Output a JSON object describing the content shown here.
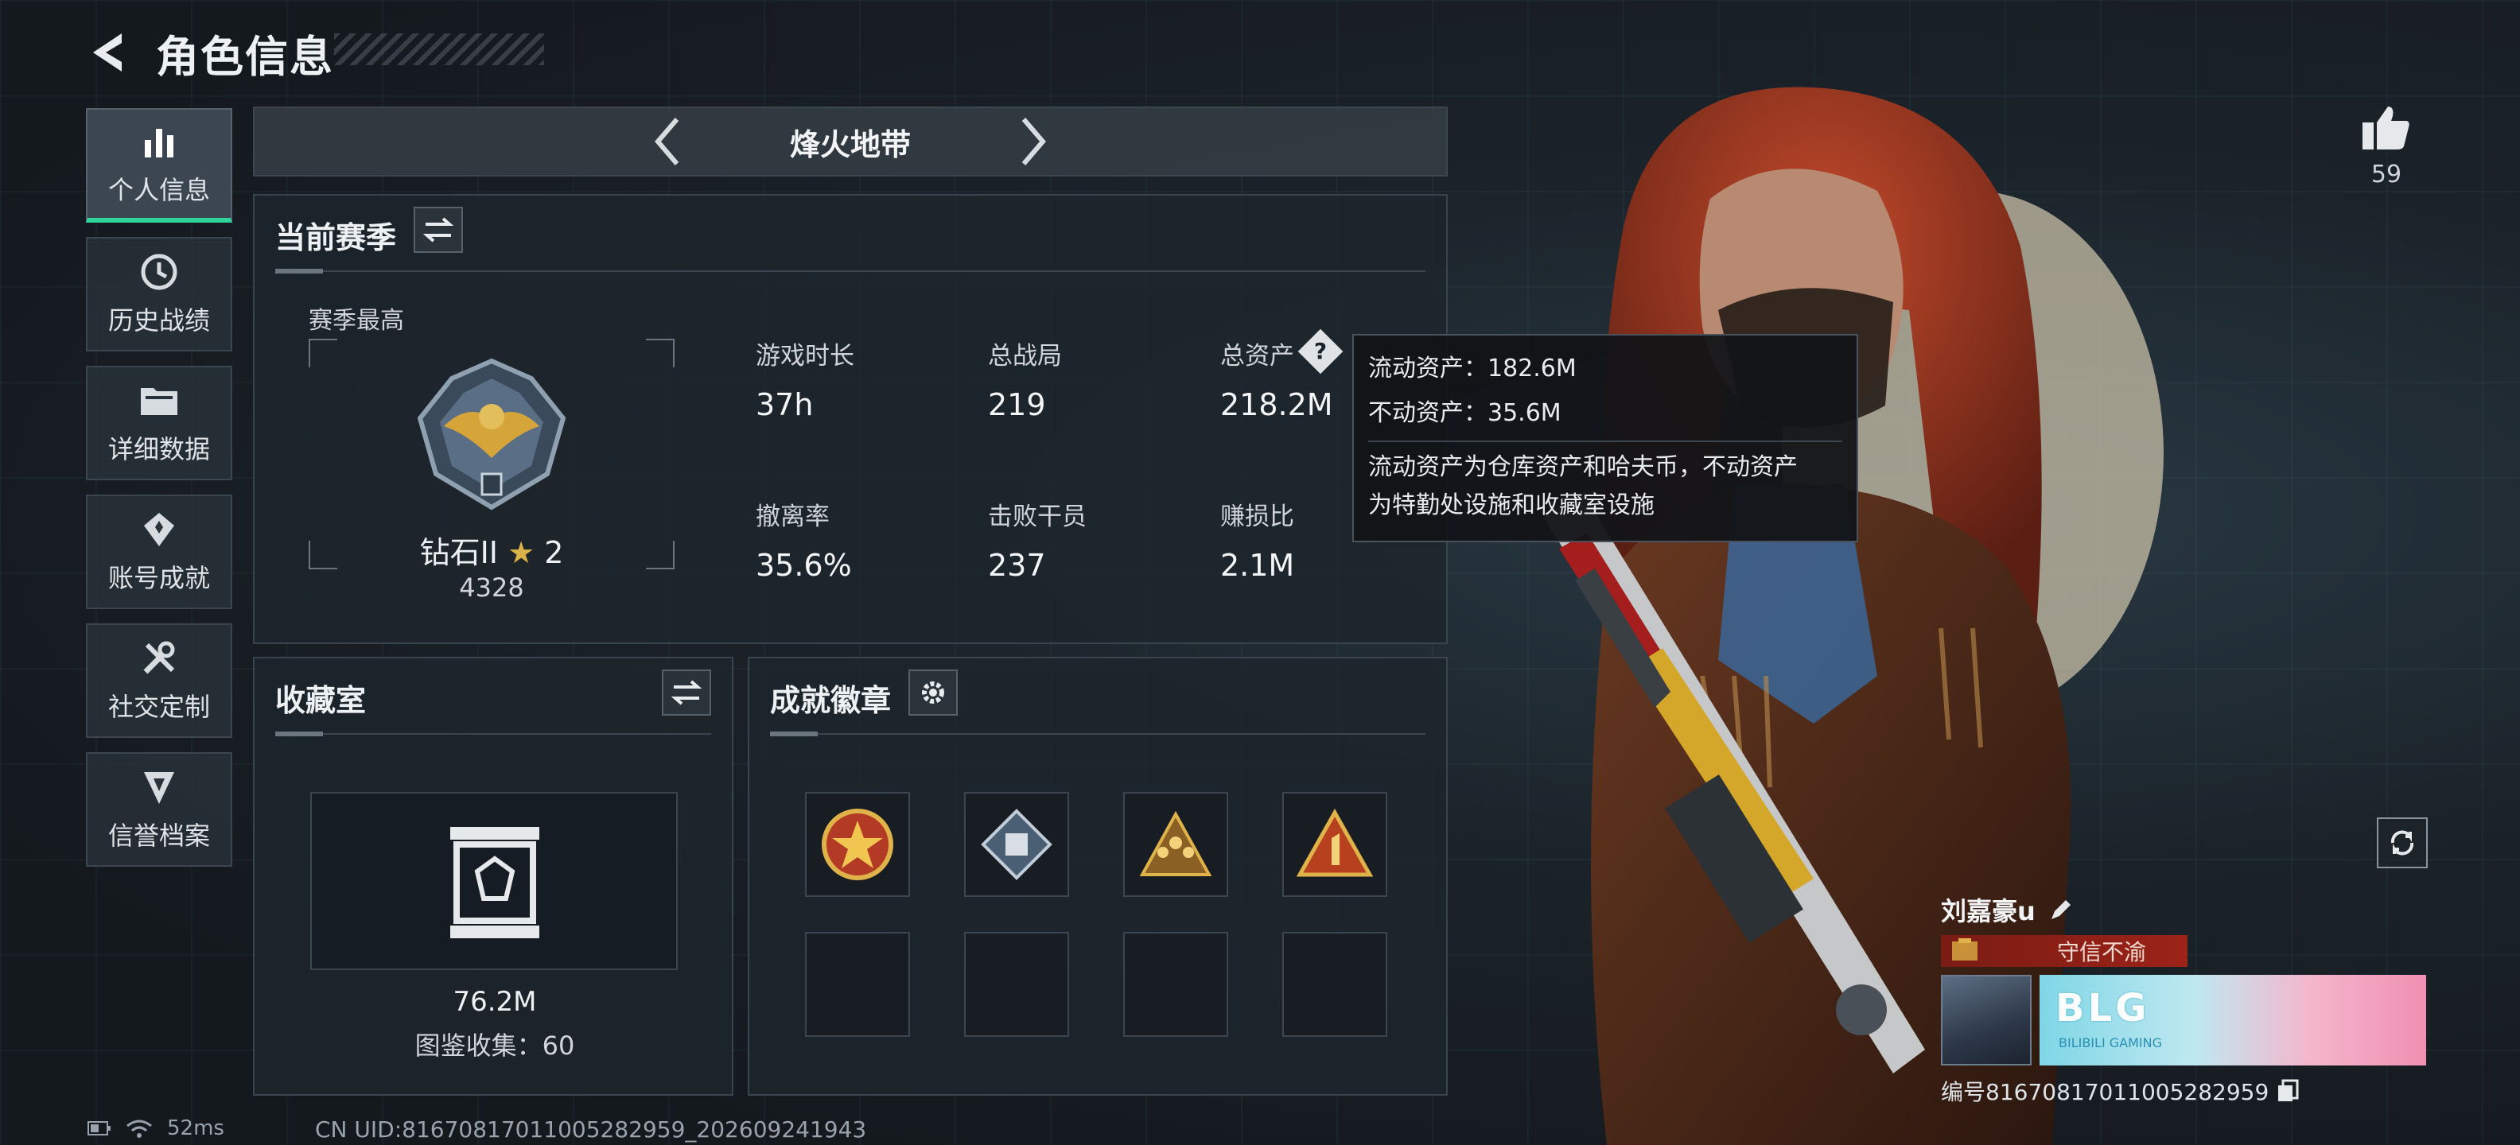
{
  "header": {
    "title": "角色信息"
  },
  "sidebar": {
    "items": [
      {
        "label": "个人信息",
        "icon": "bar-chart-icon",
        "active": true
      },
      {
        "label": "历史战绩",
        "icon": "history-icon",
        "active": false
      },
      {
        "label": "详细数据",
        "icon": "folder-icon",
        "active": false
      },
      {
        "label": "账号成就",
        "icon": "achievement-icon",
        "active": false
      },
      {
        "label": "社交定制",
        "icon": "tools-icon",
        "active": false
      },
      {
        "label": "信誉档案",
        "icon": "shield-icon",
        "active": false
      }
    ]
  },
  "mode": {
    "name": "烽火地带"
  },
  "season": {
    "title": "当前赛季",
    "best_label": "赛季最高",
    "rank_name": "钻石II",
    "rank_stars": "2",
    "rank_score": "4328",
    "stats": [
      {
        "label": "游戏时长",
        "value": "37h"
      },
      {
        "label": "总战局",
        "value": "219"
      },
      {
        "label": "总资产",
        "value": "218.2M"
      },
      {
        "label": "撤离率",
        "value": "35.6%"
      },
      {
        "label": "击败干员",
        "value": "237"
      },
      {
        "label": "赚损比",
        "value": "2.1M"
      }
    ]
  },
  "tooltip": {
    "liquid": "流动资产：182.6M",
    "fixed": "不动资产：35.6M",
    "desc_line1": "流动资产为仓库资产和哈夫币，不动资产",
    "desc_line2": "为特勤处设施和收藏室设施"
  },
  "collection": {
    "title": "收藏室",
    "value": "76.2M",
    "count_label": "图鉴收集：60"
  },
  "badges": {
    "title": "成就徽章",
    "items": [
      "star-medal-icon",
      "diamond-crate-icon",
      "soldiers-badge-icon",
      "number-one-badge-icon"
    ]
  },
  "like": {
    "count": "59"
  },
  "player": {
    "name": "刘嘉豪u",
    "title_text": "守信不渝",
    "banner_text": "BLG",
    "banner_sub": "BILIBILI GAMING",
    "id_label": "编号8167081701100528​2959"
  },
  "status": {
    "ping": "52ms",
    "uid": "CN UID:8167081701100528​2959_202609241943"
  },
  "colors": {
    "accent": "#2fd49a",
    "title_red": "#9c2318"
  }
}
